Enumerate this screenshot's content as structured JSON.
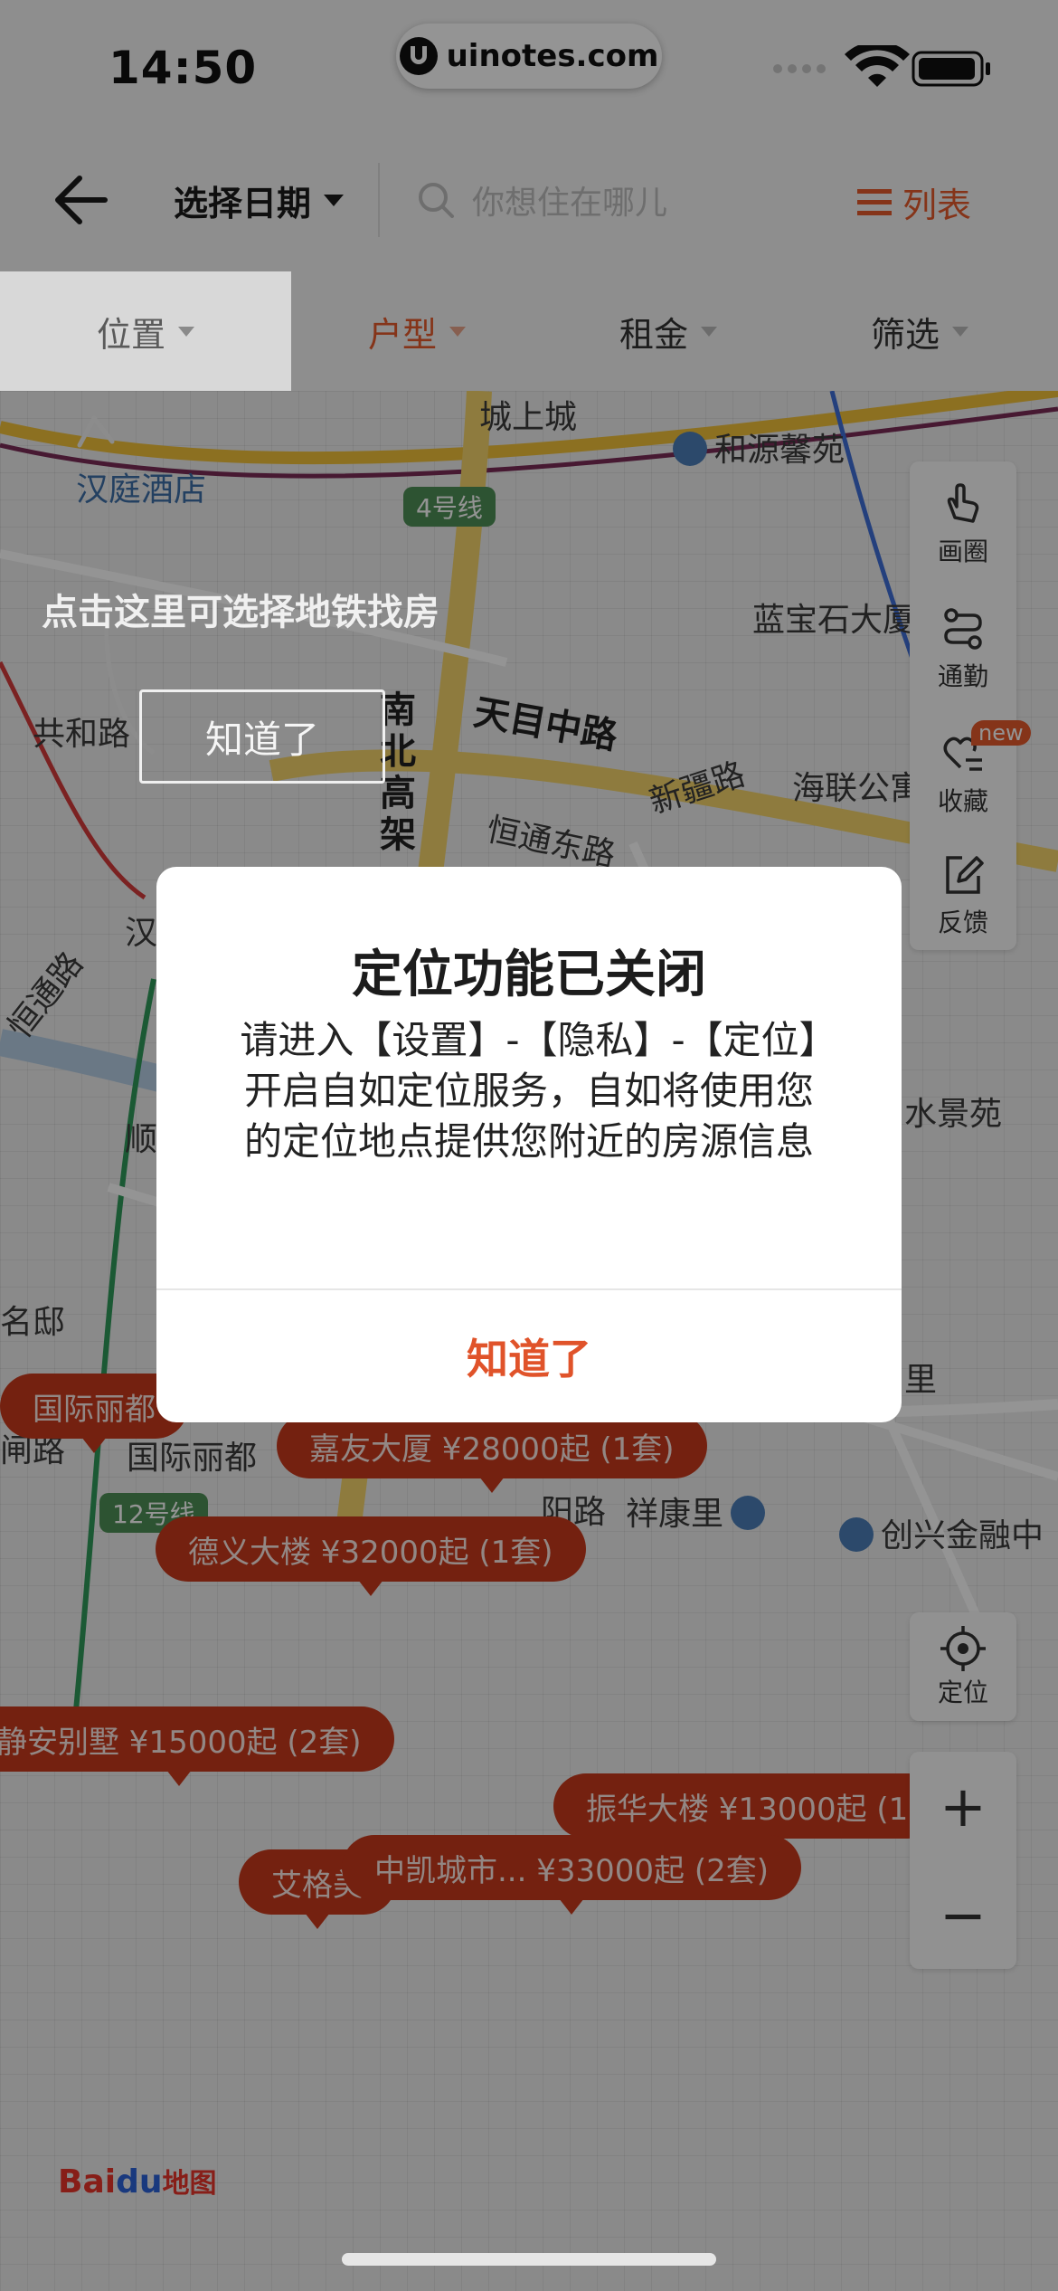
{
  "status_bar": {
    "time": "14:50",
    "watermark": "uinotes.com"
  },
  "nav": {
    "date_label": "选择日期",
    "search_placeholder": "你想住在哪儿",
    "list_label": "列表"
  },
  "filters": [
    {
      "label": "位置"
    },
    {
      "label": "户型"
    },
    {
      "label": "租金"
    },
    {
      "label": "筛选"
    }
  ],
  "map": {
    "pois": {
      "hanting": "汉庭酒店",
      "chengshangcheng": "城上城",
      "heyuan": "和源馨苑",
      "lanbaoshi": "蓝宝石大厦",
      "haihualian": "海联公寓",
      "gonghe": "共和路",
      "shuijing": "水景苑",
      "mingdi": "名邸",
      "guojilidu": "国际丽都",
      "xiangkang": "祥康里",
      "chuangxing": "创兴金融中",
      "li": "里"
    },
    "roads": {
      "tianmu": "天目中路",
      "nanbei": "南北高架",
      "xinjiang": "新疆路",
      "hengtong": "恒通东路",
      "hengtong_west": "恒通路",
      "shun": "顺",
      "han": "汉",
      "lan": "闸路",
      "yang": "阳路"
    },
    "line_badges": {
      "l4": "4号线",
      "l12": "12号线"
    },
    "price_pins": [
      {
        "label": "国际丽都"
      },
      {
        "label": "嘉友大厦 ¥28000起 (1套)"
      },
      {
        "label": "德义大楼 ¥32000起 (1套)"
      },
      {
        "label": "静安别墅 ¥15000起 (2套)"
      },
      {
        "label": "振华大楼 ¥13000起 (1"
      },
      {
        "label": "艾格美"
      },
      {
        "label": "中凯城市... ¥33000起 (2套)"
      }
    ],
    "tools": {
      "circle": "画圈",
      "commute": "通勤",
      "favorite": "收藏",
      "new_badge": "new",
      "feedback": "反馈",
      "locate": "定位"
    },
    "zoom": {
      "in": "+",
      "out": "−"
    },
    "baidu_logo": {
      "bai": "Bai",
      "du": "du",
      "zh": "地图"
    }
  },
  "tip": {
    "text": "点击这里可选择地铁找房",
    "button": "知道了"
  },
  "modal": {
    "title": "定位功能已关闭",
    "body": "请进入【设置】-【隐私】-【定位】开启自如定位服务，自如将使用您的定位地点提供您附近的房源信息",
    "confirm": "知道了"
  },
  "colors": {
    "accent": "#e55a2c",
    "pin": "#c9391c",
    "modal_confirm": "#e0532a"
  }
}
